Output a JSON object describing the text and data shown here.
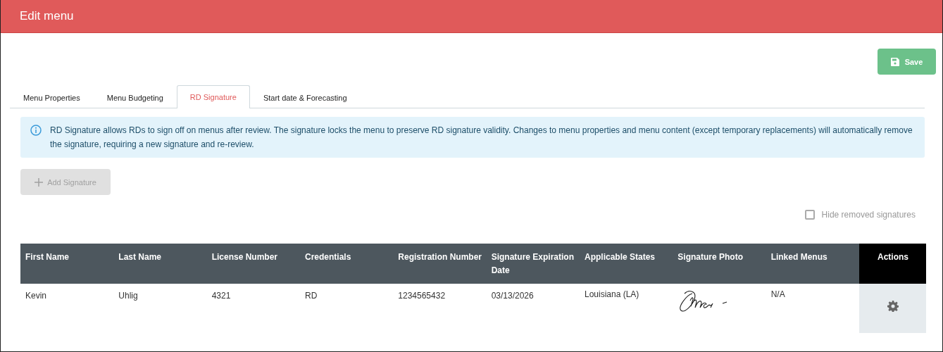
{
  "header": {
    "title": "Edit menu"
  },
  "save_button": {
    "label": "Save"
  },
  "tabs": [
    {
      "label": "Menu Properties",
      "selected": false
    },
    {
      "label": "Menu Budgeting",
      "selected": false
    },
    {
      "label": "RD Signature",
      "selected": true
    },
    {
      "label": "Start date & Forecasting",
      "selected": false
    }
  ],
  "info": {
    "text": "RD Signature allows RDs to sign off on menus after review. The signature locks the menu to preserve RD signature validity. Changes to menu properties and menu content (except temporary replacements) will automatically remove the signature, requiring a new signature and re-review."
  },
  "add_button": {
    "label": "Add Signature",
    "disabled": true
  },
  "hide_removed": {
    "label": "Hide removed signatures",
    "checked": false
  },
  "table": {
    "columns": [
      "First Name",
      "Last Name",
      "License Number",
      "Credentials",
      "Registration Number",
      "Signature Expiration Date",
      "Applicable States",
      "Signature Photo",
      "Linked Menus",
      "Actions"
    ],
    "rows": [
      {
        "cells": [
          "Kevin",
          "Uhlig",
          "4321",
          "RD",
          "1234565432",
          "03/13/2026",
          "Louisiana (LA)"
        ],
        "signature": {
          "kind": "signature"
        },
        "linked_menus": "N/A"
      }
    ]
  }
}
